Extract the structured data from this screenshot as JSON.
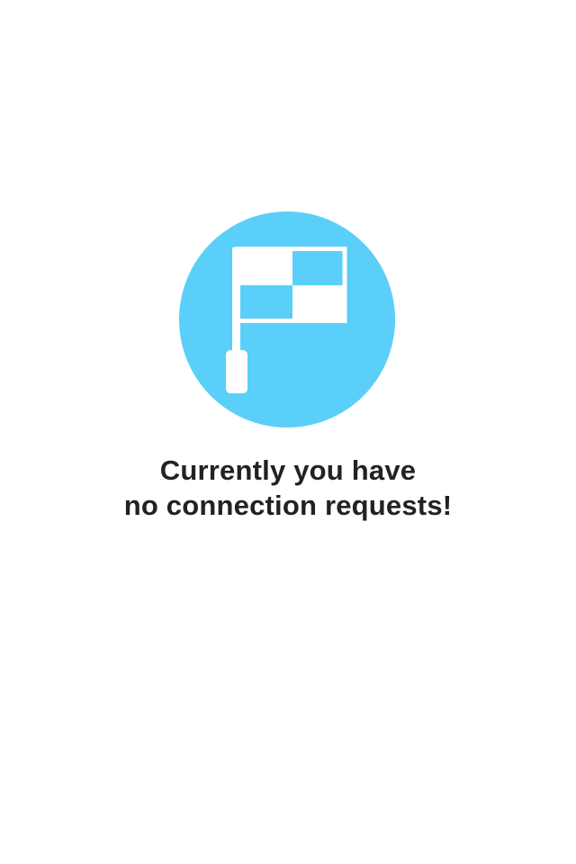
{
  "empty_state": {
    "icon": "checkered-flag-icon",
    "accent_color": "#5ACFFA",
    "message_line1": "Currently you have",
    "message_line2": "no connection requests!"
  }
}
